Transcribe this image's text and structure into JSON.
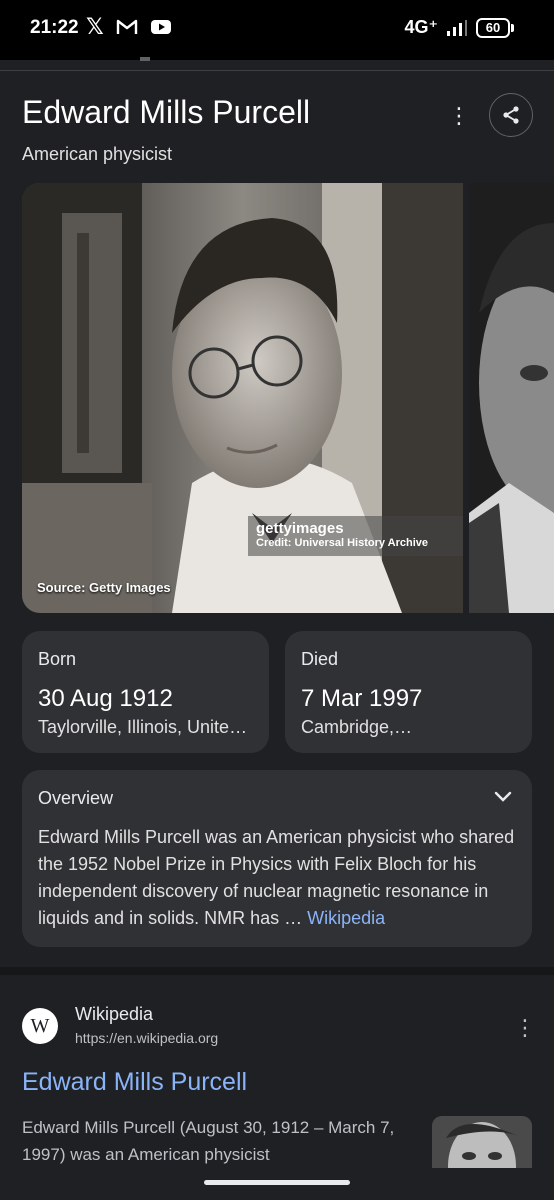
{
  "status_bar": {
    "time": "21:22",
    "network": "4G⁺",
    "battery": "60"
  },
  "knowledge_panel": {
    "title": "Edward Mills Purcell",
    "subtitle": "American physicist",
    "image": {
      "source_text": "Source: Getty Images",
      "watermark_brand": "gettyimages",
      "watermark_credit": "Credit: Universal History Archive"
    },
    "born": {
      "label": "Born",
      "date": "30 Aug 1912",
      "place": "Taylorville, Illinois, Unite…"
    },
    "died": {
      "label": "Died",
      "date": "7 Mar 1997",
      "place": "Cambridge,…"
    },
    "overview": {
      "title": "Overview",
      "text": "Edward Mills Purcell was an American physicist who shared the 1952 Nobel Prize in Physics with Felix Bloch for his independent discovery of nuclear magnetic resonance in liquids and in solids. NMR has",
      "ellipsis": " … ",
      "link_label": "Wikipedia"
    }
  },
  "search_result": {
    "site_logo_letter": "W",
    "site_name": "Wikipedia",
    "url": "https://en.wikipedia.org",
    "title": "Edward Mills Purcell",
    "snippet": "Edward Mills Purcell (August 30, 1912 – March 7, 1997) was an American physicist"
  },
  "colors": {
    "background": "#1f2023",
    "card": "#303134",
    "link": "#8ab4f8"
  }
}
